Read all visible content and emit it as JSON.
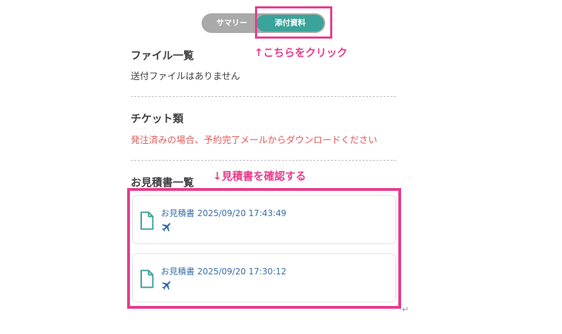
{
  "toggle": {
    "summary_label": "サマリー",
    "attachments_label": "添付資料"
  },
  "annotations": {
    "click_here": "↑こちらをクリック",
    "check_quote": "↓見積書を確認する"
  },
  "file_list": {
    "title": "ファイル一覧",
    "empty_text": "送付ファイルはありません"
  },
  "tickets": {
    "title": "チケット類",
    "note": "発注済みの場合、予約完了メールからダウンロードください"
  },
  "quotes": {
    "title": "お見積書一覧",
    "items": [
      {
        "label": "お見積書 2025/09/20 17:43:49",
        "icon": "airplane-icon"
      },
      {
        "label": "お見積書 2025/09/20 17:30:12",
        "icon": "airplane-icon"
      }
    ]
  },
  "colors": {
    "accent_teal": "#3aa39a",
    "highlight_pink": "#e63c8d",
    "toggle_gray": "#a9a9a9",
    "warning_red": "#e25a5a",
    "link_blue": "#3a6ea8"
  }
}
